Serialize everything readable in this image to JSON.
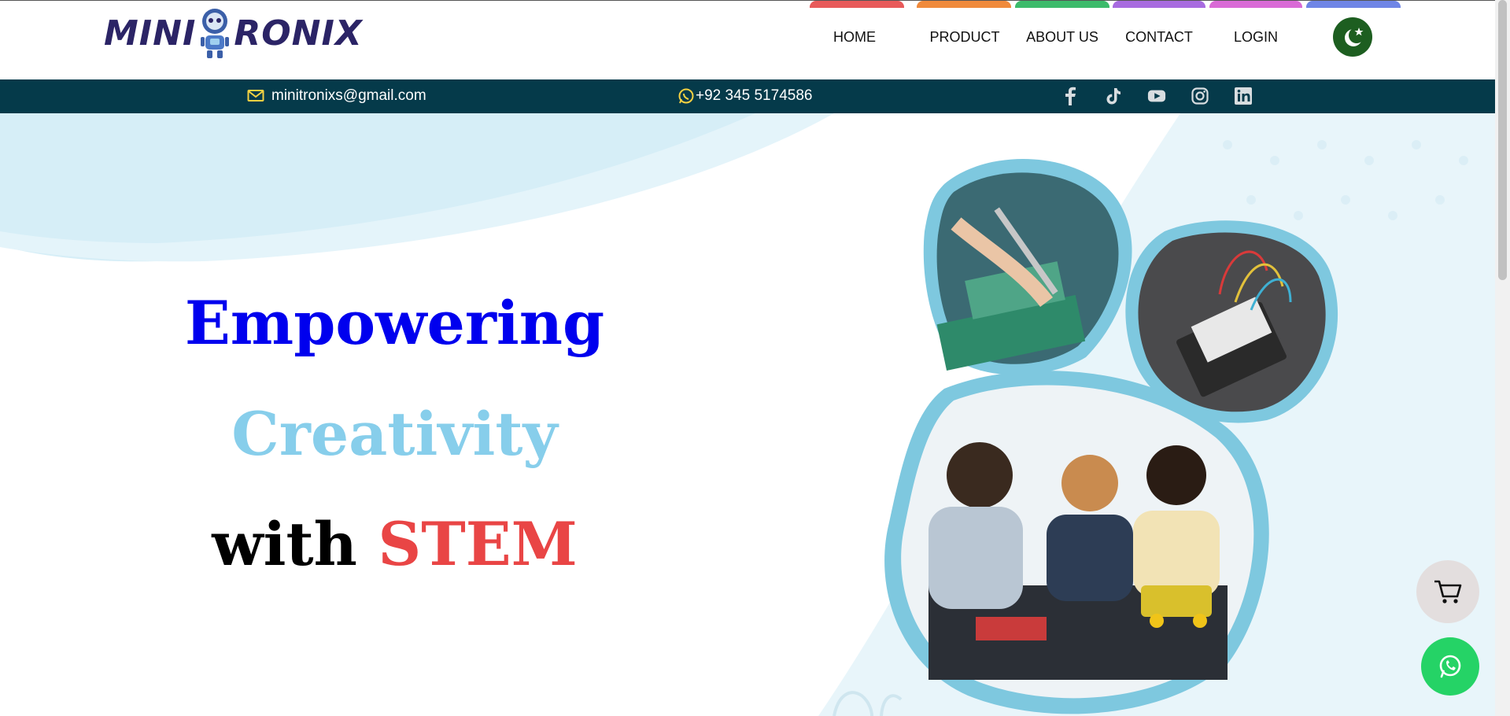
{
  "brand": {
    "logo_left": "MINI",
    "logo_right": "RONIX"
  },
  "nav": {
    "items": [
      {
        "label": "HOME",
        "color": "#e85a5a"
      },
      {
        "label": "PRODUCT",
        "color": "#f08a3c"
      },
      {
        "label": "ABOUT US",
        "color": "#3dbb6b"
      },
      {
        "label": "CONTACT",
        "color": "#a86be0"
      },
      {
        "label": "LOGIN",
        "color": "#d96ad6"
      }
    ],
    "extra_bar_color": "#6f85e6"
  },
  "contact": {
    "email": "minitronixs@gmail.com",
    "phone": "+92 345 5174586"
  },
  "social": [
    "facebook-icon",
    "tiktok-icon",
    "youtube-icon",
    "instagram-icon",
    "linkedin-icon"
  ],
  "hero": {
    "line1": "Empowering",
    "line2": "Creativity",
    "line3_a": "with ",
    "line3_b": "STEM"
  },
  "colors": {
    "topbar": "#053a4a",
    "accent_blue": "#0000ee",
    "light_blue": "#87ceeb",
    "red": "#e94545",
    "bubble_border": "#7ec8df"
  }
}
